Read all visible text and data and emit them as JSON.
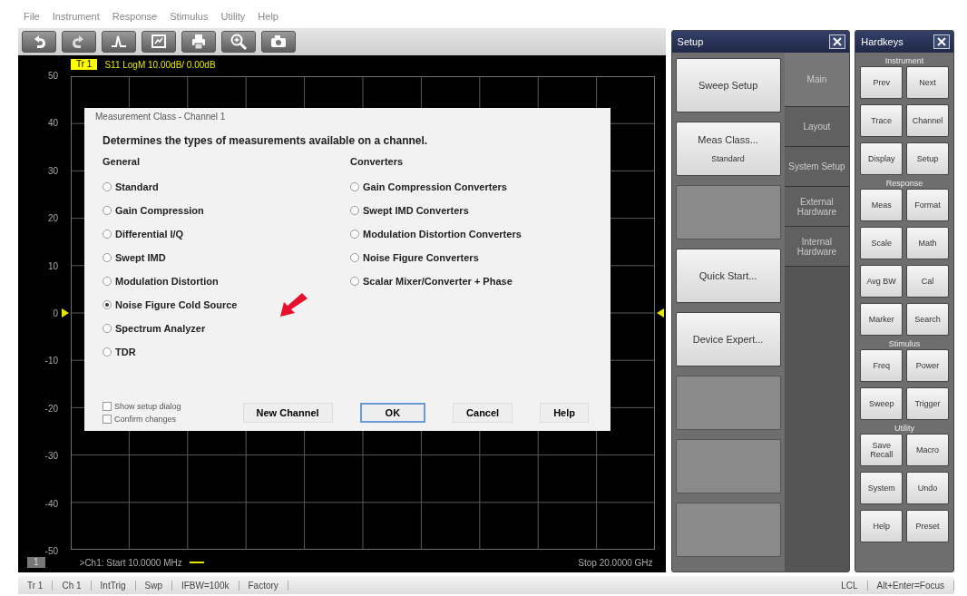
{
  "menu": [
    "File",
    "Instrument",
    "Response",
    "Stimulus",
    "Utility",
    "Help"
  ],
  "chart": {
    "trace_badge": "Tr 1",
    "trace_info": "S11 LogM 10.00dB/ 0.00dB",
    "y_labels": [
      "50",
      "40",
      "30",
      "20",
      "10",
      "0",
      "-10",
      "-20",
      "-30",
      "-40",
      "-50"
    ],
    "channel_badge": "1",
    "start": ">Ch1: Start 10.0000 MHz",
    "stop": "Stop 20.0000 GHz"
  },
  "dialog": {
    "title": "Measurement Class - Channel 1",
    "description": "Determines the types of measurements available on a channel.",
    "groups": [
      {
        "title": "General",
        "options": [
          {
            "label": "Standard",
            "selected": false
          },
          {
            "label": "Gain Compression",
            "selected": false
          },
          {
            "label": "Differential I/Q",
            "selected": false
          },
          {
            "label": "Swept IMD",
            "selected": false
          },
          {
            "label": "Modulation Distortion",
            "selected": false
          },
          {
            "label": "Noise Figure Cold Source",
            "selected": true
          },
          {
            "label": "Spectrum Analyzer",
            "selected": false
          },
          {
            "label": "TDR",
            "selected": false
          }
        ]
      },
      {
        "title": "Converters",
        "options": [
          {
            "label": "Gain Compression Converters",
            "selected": false
          },
          {
            "label": "Swept IMD Converters",
            "selected": false
          },
          {
            "label": "Modulation Distortion Converters",
            "selected": false
          },
          {
            "label": "Noise Figure Converters",
            "selected": false
          },
          {
            "label": "Scalar Mixer/Converter + Phase",
            "selected": false
          }
        ]
      }
    ],
    "checkboxes": [
      {
        "label": "Show setup dialog",
        "checked": false
      },
      {
        "label": "Confirm changes",
        "checked": false
      }
    ],
    "buttons": [
      {
        "label": "New Channel",
        "default": false
      },
      {
        "label": "OK",
        "default": true
      },
      {
        "label": "Cancel",
        "default": false
      },
      {
        "label": "Help",
        "default": false
      }
    ]
  },
  "setup": {
    "title": "Setup",
    "buttons": [
      {
        "kind": "action",
        "label": "Sweep Setup"
      },
      {
        "kind": "action",
        "label": "Meas Class...",
        "sublabel": "Standard"
      },
      {
        "kind": "blank"
      },
      {
        "kind": "action",
        "label": "Quick Start..."
      },
      {
        "kind": "action",
        "label": "Device Expert..."
      },
      {
        "kind": "blank"
      },
      {
        "kind": "blank"
      },
      {
        "kind": "blank"
      }
    ],
    "tabs": [
      {
        "label": "Main",
        "selected": true
      },
      {
        "label": "Layout",
        "selected": false
      },
      {
        "label": "System Setup",
        "selected": false
      },
      {
        "label": "External Hardware",
        "selected": false
      },
      {
        "label": "Internal Hardware",
        "selected": false
      }
    ]
  },
  "hardkeys": {
    "title": "Hardkeys",
    "sections": [
      {
        "title": "Instrument",
        "keys": [
          "Prev",
          "Next",
          "Trace",
          "Channel",
          "Display",
          "Setup"
        ]
      },
      {
        "title": "Response",
        "keys": [
          "Meas",
          "Format",
          "Scale",
          "Math",
          "Avg BW",
          "Cal",
          "Marker",
          "Search"
        ]
      },
      {
        "title": "Stimulus",
        "keys": [
          "Freq",
          "Power",
          "Sweep",
          "Trigger"
        ]
      },
      {
        "title": "Utility",
        "keys": [
          "Save Recall",
          "Macro",
          "System",
          "Undo",
          "Help",
          "Preset"
        ]
      }
    ]
  },
  "status_bar": {
    "left": [
      "Tr 1",
      "Ch 1",
      "IntTrig",
      "Swp",
      "IFBW=100k",
      "Factory"
    ],
    "right": [
      "LCL",
      "Alt+Enter=Focus"
    ]
  }
}
